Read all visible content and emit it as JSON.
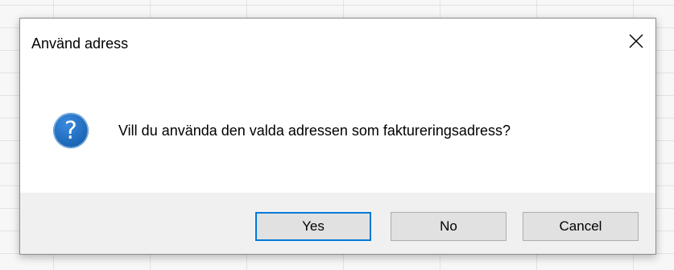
{
  "dialog": {
    "title": "Använd adress",
    "message": "Vill du använda den valda adressen som faktureringsadress?",
    "icon": "question-icon",
    "close_icon": "close-icon",
    "buttons": {
      "yes_label": "Yes",
      "no_label": "No",
      "cancel_label": "Cancel"
    },
    "default_button": "yes"
  },
  "colors": {
    "accent": "#0078d7",
    "icon_fill": "#1f6fbf",
    "footer_bg": "#f0f0f0",
    "button_bg": "#e1e1e1",
    "button_border": "#adadad"
  }
}
